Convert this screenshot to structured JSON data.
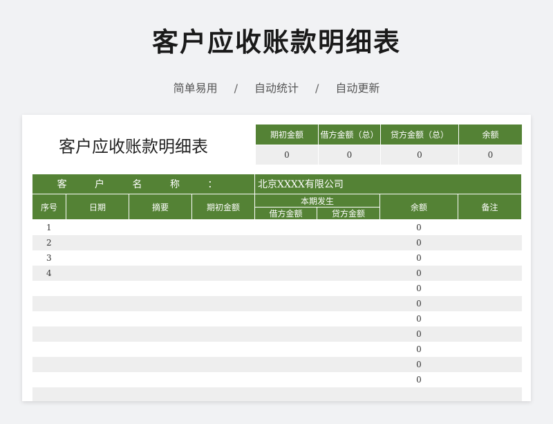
{
  "header": {
    "title": "客户应收账款明细表",
    "features": [
      "简单易用",
      "自动统计",
      "自动更新"
    ],
    "separator": "/"
  },
  "sheet": {
    "title": "客户应收账款明细表",
    "summary": {
      "headers": [
        "期初金额",
        "借方金额（总）",
        "贷方金额（总）",
        "余额"
      ],
      "values": [
        "0",
        "0",
        "0",
        "0"
      ]
    },
    "customer": {
      "label": "客 户 名 称 ：",
      "value": "北京XXXX有限公司"
    },
    "columns": {
      "seq": "序号",
      "date": "日期",
      "summary": "摘要",
      "opening": "期初金额",
      "period_group": "本期发生",
      "debit": "借方金额",
      "credit": "贷方金额",
      "balance": "余额",
      "remark": "备注"
    },
    "rows": [
      {
        "seq": "1",
        "balance": "0"
      },
      {
        "seq": "2",
        "balance": "0"
      },
      {
        "seq": "3",
        "balance": "0"
      },
      {
        "seq": "4",
        "balance": "0"
      },
      {
        "seq": "",
        "balance": "0"
      },
      {
        "seq": "",
        "balance": "0"
      },
      {
        "seq": "",
        "balance": "0"
      },
      {
        "seq": "",
        "balance": "0"
      },
      {
        "seq": "",
        "balance": "0"
      },
      {
        "seq": "",
        "balance": "0"
      },
      {
        "seq": "",
        "balance": "0"
      },
      {
        "seq": "",
        "balance": ""
      }
    ]
  }
}
